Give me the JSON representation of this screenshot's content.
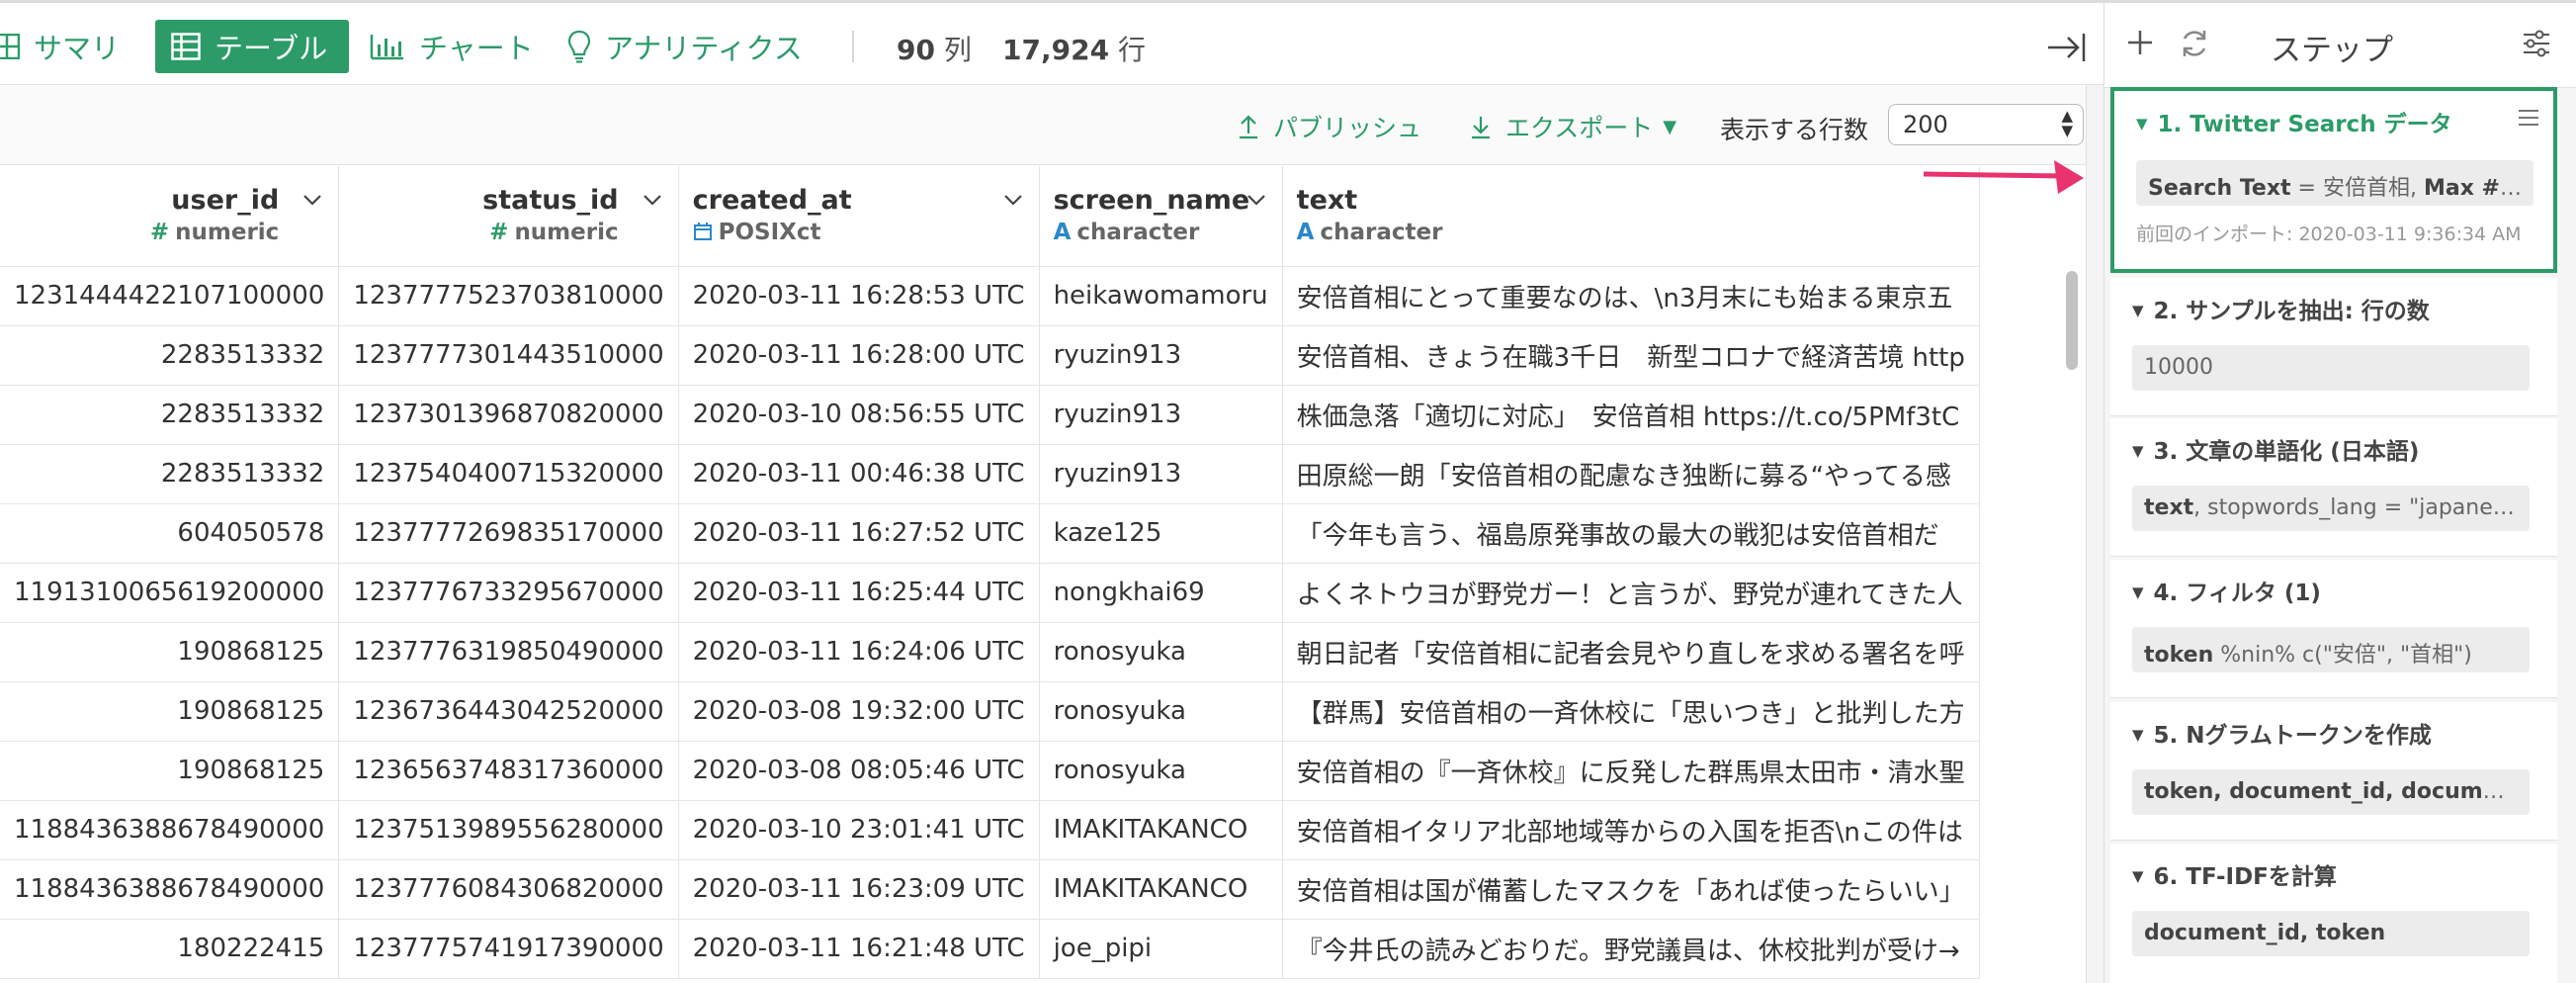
{
  "tabs": {
    "summary": "サマリ",
    "table": "テーブル",
    "chart": "チャート",
    "analytics": "アナリティクス"
  },
  "counts": {
    "cols_value": "90",
    "cols_unit": "列",
    "rows_value": "17,924",
    "rows_unit": "行"
  },
  "toolbar": {
    "publish": "パブリッシュ",
    "export": "エクスポート",
    "rows_label": "表示する行数",
    "rows_value": "200"
  },
  "columns": [
    {
      "name": "user_id",
      "type": "numeric",
      "type_icon": "#"
    },
    {
      "name": "status_id",
      "type": "numeric",
      "type_icon": "#"
    },
    {
      "name": "created_at",
      "type": "POSIXct",
      "type_icon": "calendar-icon"
    },
    {
      "name": "screen_name",
      "type": "character",
      "type_icon": "A"
    },
    {
      "name": "text",
      "type": "character",
      "type_icon": "A"
    }
  ],
  "rows": [
    [
      "1231444422107100000",
      "1237777523703810000",
      "2020-03-11 16:28:53 UTC",
      "heikawomamoru",
      "安倍首相にとって重要なのは、\\n3月末にも始まる東京五"
    ],
    [
      "2283513332",
      "1237777301443510000",
      "2020-03-11 16:28:00 UTC",
      "ryuzin913",
      "安倍首相、きょう在職3千日　新型コロナで経済苦境 http"
    ],
    [
      "2283513332",
      "1237301396870820000",
      "2020-03-10 08:56:55 UTC",
      "ryuzin913",
      "株価急落「適切に対応」　安倍首相 https://t.co/5PMf3tC"
    ],
    [
      "2283513332",
      "1237540400715320000",
      "2020-03-11 00:46:38 UTC",
      "ryuzin913",
      "田原総一朗「安倍首相の配慮なき独断に募る“やってる感"
    ],
    [
      "604050578",
      "1237777269835170000",
      "2020-03-11 16:27:52 UTC",
      "kaze125",
      "「今年も言う、福島原発事故の最大の戦犯は安倍首相だ"
    ],
    [
      "1191310065619200000",
      "1237776733295670000",
      "2020-03-11 16:25:44 UTC",
      "nongkhai69",
      "よくネトウヨが野党ガー！と言うが、野党が連れてきた人"
    ],
    [
      "190868125",
      "1237776319850490000",
      "2020-03-11 16:24:06 UTC",
      "ronosyuka",
      "朝日記者「安倍首相に記者会見やり直しを求める署名を呼"
    ],
    [
      "190868125",
      "1236736443042520000",
      "2020-03-08 19:32:00 UTC",
      "ronosyuka",
      "【群馬】安倍首相の一斉休校に「思いつき」と批判した方"
    ],
    [
      "190868125",
      "1236563748317360000",
      "2020-03-08 08:05:46 UTC",
      "ronosyuka",
      "安倍首相の『一斉休校』に反発した群馬県太田市・清水聖"
    ],
    [
      "1188436388678490000",
      "1237513989556280000",
      "2020-03-10 23:01:41 UTC",
      "IMAKITAKANCO",
      "安倍首相イタリア北部地域等からの入国を拒否\\nこの件は"
    ],
    [
      "1188436388678490000",
      "1237776084306820000",
      "2020-03-11 16:23:09 UTC",
      "IMAKITAKANCO",
      "安倍首相は国が備蓄したマスクを「あれば使ったらいい」"
    ],
    [
      "180222415",
      "1237775741917390000",
      "2020-03-11 16:21:48 UTC",
      "joe_pipi",
      "『今井氏の読みどおりだ。野党議員は、休校批判が受け→"
    ]
  ],
  "panel": {
    "title": "ステップ",
    "steps": [
      {
        "title": "1. Twitter Search データ",
        "body_key": "Search Text",
        "body_rest": " = 安倍首相, ",
        "body_key2": "Max # ...",
        "meta": "前回のインポート: 2020-03-11 9:36:34 AM"
      },
      {
        "title": "2. サンプルを抽出: 行の数",
        "body": "10000"
      },
      {
        "title": "3. 文章の単語化 (日本語)",
        "body_key": "text",
        "body_rest": ", stopwords_lang = \"japanese\""
      },
      {
        "title": "4. フィルタ (1)",
        "body_key": "token",
        "body_rest": " %nin% c(\"安倍\", \"首相\")"
      },
      {
        "title": "5. Nグラムトークンを作成",
        "body_key": "token, document_id, document…",
        "body_rest": ""
      },
      {
        "title": "6. TF-IDFを計算",
        "body_key": "document_id, token",
        "body_rest": ""
      }
    ]
  },
  "colors": {
    "accent": "#2c9b68",
    "arrow": "#e8336d"
  }
}
